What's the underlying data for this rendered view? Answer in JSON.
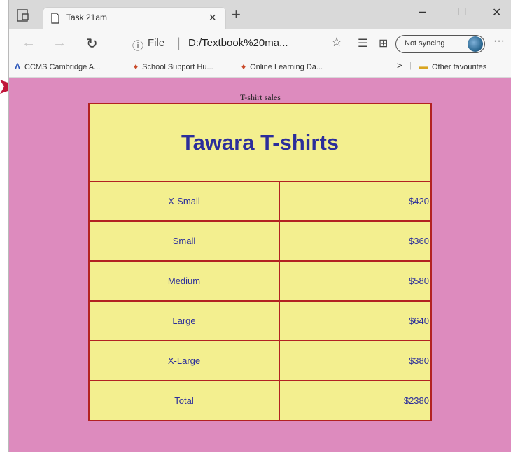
{
  "browser": {
    "tab": {
      "title": "Task 21am",
      "close": "×"
    },
    "new_tab": "+",
    "window_controls": {
      "minimize": "–",
      "maximize": "☐",
      "close": "✕"
    },
    "toolbar": {
      "back": "←",
      "forward": "→",
      "refresh": "↻",
      "address": {
        "info": "ⓘ",
        "scheme": "File",
        "separator": "|",
        "url": "D:/Textbook%20ma..."
      },
      "favorite": "☆",
      "favorites_list": "☰",
      "collections": "⊞",
      "sync_label": "Not syncing",
      "more": "···"
    },
    "bookmarks": [
      {
        "label": "CCMS Cambridge A...",
        "icon": "a-logo-icon"
      },
      {
        "label": "School Support Hu...",
        "icon": "crest-icon"
      },
      {
        "label": "Online Learning Da...",
        "icon": "crest-icon"
      }
    ],
    "bookmarks_overflow": ">",
    "other_favourites": "Other favourites"
  },
  "page": {
    "caption": "T-shirt sales",
    "heading": "Tawara T-shirts",
    "rows": [
      {
        "size": "X-Small",
        "amount": "$420"
      },
      {
        "size": "Small",
        "amount": "$360"
      },
      {
        "size": "Medium",
        "amount": "$580"
      },
      {
        "size": "Large",
        "amount": "$640"
      },
      {
        "size": "X-Large",
        "amount": "$380"
      }
    ],
    "total": {
      "label": "Total",
      "amount": "$2380"
    }
  },
  "colors": {
    "page_background": "#dd8bbe",
    "table_background": "#f3ef8f",
    "table_border": "#b22222",
    "text_blue": "#2b2e9b",
    "total_text": "#b22222",
    "pointer_arrow": "#c0163a"
  }
}
